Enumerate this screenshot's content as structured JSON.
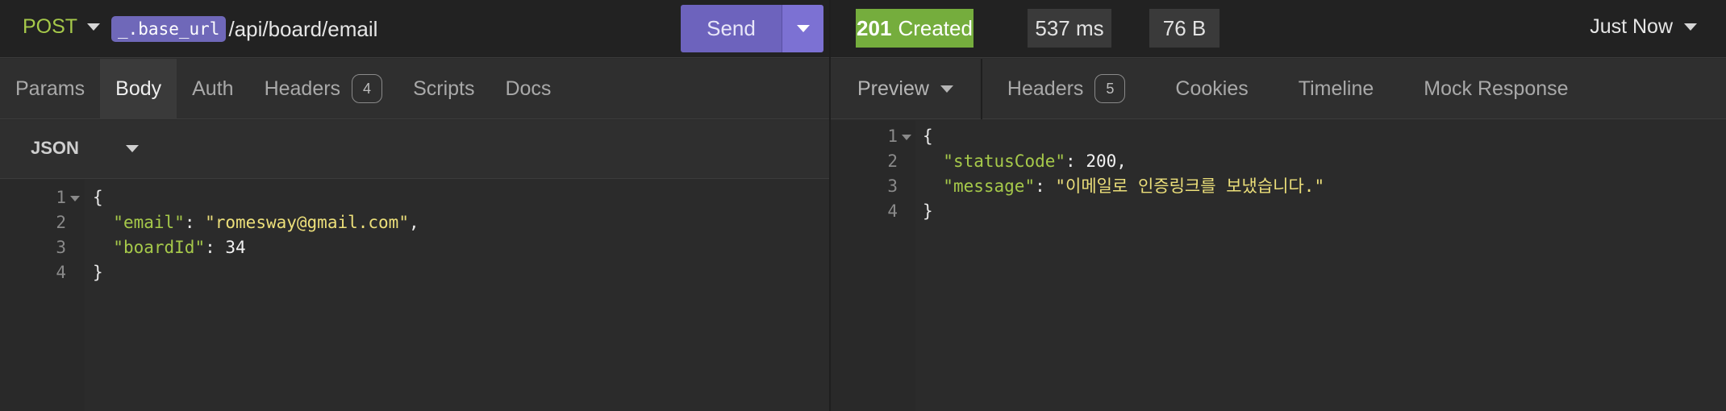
{
  "request": {
    "method": "POST",
    "url_variable": "_.base_url",
    "url_path": "/api/board/email",
    "send_label": "Send",
    "tabs": [
      {
        "label": "Params"
      },
      {
        "label": "Body"
      },
      {
        "label": "Auth"
      },
      {
        "label": "Headers",
        "count": "4"
      },
      {
        "label": "Scripts"
      },
      {
        "label": "Docs"
      }
    ],
    "body_type": "JSON",
    "body_lines": [
      {
        "num": "1",
        "brace": "{"
      },
      {
        "num": "2",
        "key": "\"email\"",
        "value": "\"romesway@gmail.com\""
      },
      {
        "num": "3",
        "key": "\"boardId\"",
        "value": "34"
      },
      {
        "num": "4",
        "brace": "}"
      }
    ]
  },
  "response": {
    "status_code": "201",
    "status_text": "Created",
    "time": "537 ms",
    "size": "76 B",
    "history_label": "Just Now",
    "preview_label": "Preview",
    "tabs": [
      {
        "label": "Headers",
        "count": "5"
      },
      {
        "label": "Cookies"
      },
      {
        "label": "Timeline"
      },
      {
        "label": "Mock Response"
      }
    ],
    "body_lines": [
      {
        "num": "1",
        "brace": "{"
      },
      {
        "num": "2",
        "key": "\"statusCode\"",
        "value": "200"
      },
      {
        "num": "3",
        "key": "\"message\"",
        "value": "\"이메일로 인증링크를 보냈습니다.\""
      },
      {
        "num": "4",
        "brace": "}"
      }
    ]
  },
  "colors": {
    "method": "#a6c94a",
    "send_button": "#6d63bd",
    "status_success": "#75ad3d",
    "json_key": "#a6c94a",
    "json_string": "#ecdf7a"
  }
}
